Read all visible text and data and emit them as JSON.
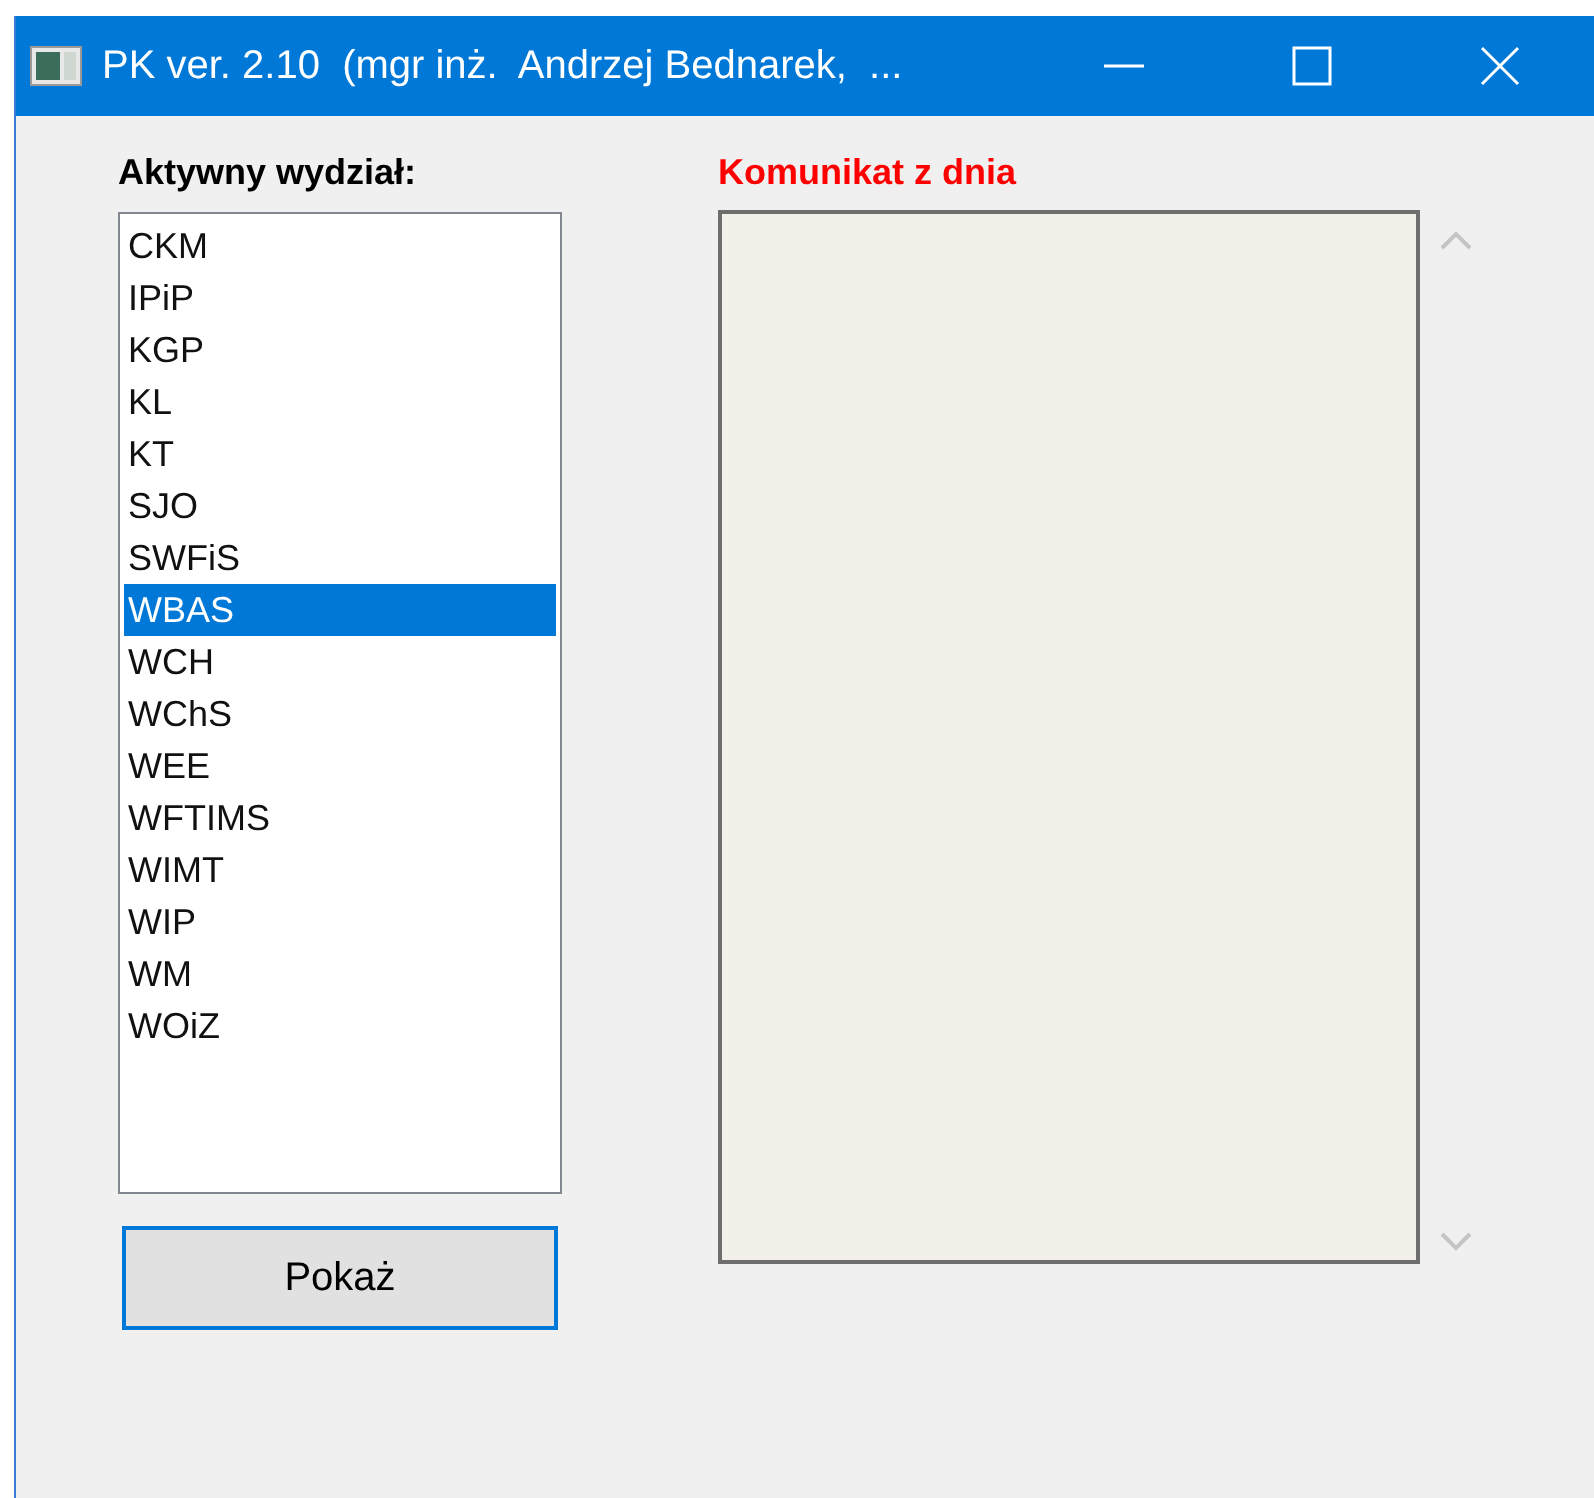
{
  "window": {
    "title": "PK ver. 2.10  (mgr inż.  Andrzej Bednarek,  ..."
  },
  "departments": {
    "label": "Aktywny wydział:",
    "items": [
      {
        "label": "CKM",
        "selected": false
      },
      {
        "label": "IPiP",
        "selected": false
      },
      {
        "label": "KGP",
        "selected": false
      },
      {
        "label": "KL",
        "selected": false
      },
      {
        "label": "KT",
        "selected": false
      },
      {
        "label": "SJO",
        "selected": false
      },
      {
        "label": "SWFiS",
        "selected": false
      },
      {
        "label": "WBAS",
        "selected": true
      },
      {
        "label": "WCH",
        "selected": false
      },
      {
        "label": "WChS",
        "selected": false
      },
      {
        "label": "WEE",
        "selected": false
      },
      {
        "label": "WFTIMS",
        "selected": false
      },
      {
        "label": "WIMT",
        "selected": false
      },
      {
        "label": "WIP",
        "selected": false
      },
      {
        "label": "WM",
        "selected": false
      },
      {
        "label": "WOiZ",
        "selected": false
      }
    ]
  },
  "show_button": {
    "label": "Pokaż",
    "focused": true
  },
  "message": {
    "label": "Komunikat z dnia"
  }
}
